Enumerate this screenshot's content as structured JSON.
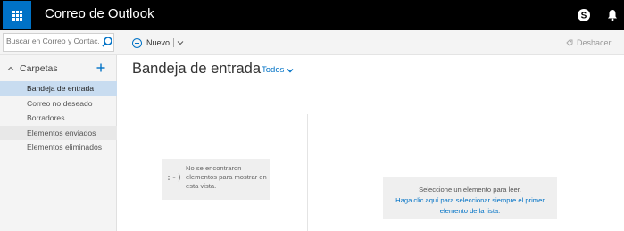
{
  "header": {
    "app_title": "Correo de Outlook",
    "accent_color": "#0072c6",
    "icons": [
      "app-launcher-icon",
      "skype-icon",
      "bell-icon"
    ]
  },
  "command_bar": {
    "search_placeholder": "Buscar en Correo y Contac...",
    "new_label": "Nuevo",
    "undo_label": "Deshacer"
  },
  "sidebar": {
    "folders_title": "Carpetas",
    "items": [
      {
        "label": "Bandeja de entrada",
        "selected": true
      },
      {
        "label": "Correo no deseado"
      },
      {
        "label": "Borradores"
      },
      {
        "label": "Elementos enviados"
      },
      {
        "label": "Elementos eliminados"
      }
    ]
  },
  "message_list": {
    "title": "Bandeja de entrada",
    "filter_label": "Todos",
    "empty_face": ":-)",
    "empty_text": "No se encontraron elementos para mostrar en esta vista."
  },
  "reading_pane": {
    "prompt": "Seleccione un elemento para leer.",
    "link_text": "Haga clic aquí para seleccionar siempre el primer elemento de la lista."
  }
}
